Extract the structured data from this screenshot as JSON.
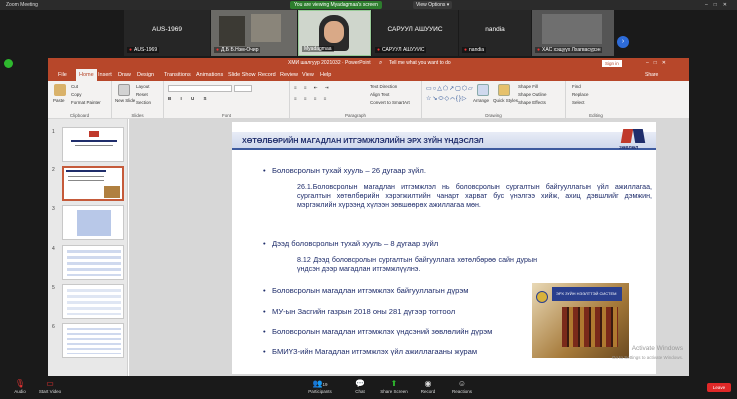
{
  "zoom": {
    "window_title": "Zoom Meeting",
    "viewing_banner": "You are viewing Myadagmaa's screen",
    "view_options": "View Options ▾",
    "participants": [
      {
        "name": "AUS-1969",
        "label": "AUS-1969"
      },
      {
        "name": "",
        "label": "Д.Б Б.Нэм-Очир"
      },
      {
        "name": "",
        "label": "Myadagmaa"
      },
      {
        "name": "САРУУЛ АШУУИС",
        "label": "САРУУЛ АШУУИС"
      },
      {
        "name": "nandia",
        "label": "nandia"
      },
      {
        "name": "",
        "label": "ХАС хэщүүх Лхагвасүрэн"
      }
    ],
    "bottom": {
      "audio": "Audio",
      "video": "Start Video",
      "participants": "Participants",
      "participants_count": "19",
      "chat": "Chat",
      "share": "Share Screen",
      "record": "Record",
      "reactions": "Reactions",
      "leave": "Leave"
    }
  },
  "ppt": {
    "title": "ХМИ шалгуур 2021032 · PowerPoint",
    "search": "Tell me what you want to do",
    "signin": "Sign in",
    "share": "Share",
    "tabs": [
      "File",
      "Home",
      "Insert",
      "Draw",
      "Design",
      "Transitions",
      "Animations",
      "Slide Show",
      "Record",
      "Review",
      "View",
      "Help"
    ],
    "ribbon": {
      "clipboard": "Clipboard",
      "paste": "Paste",
      "cut": "Cut",
      "copy": "Copy",
      "format_painter": "Format Painter",
      "slides": "Slides",
      "new_slide": "New Slide",
      "layout": "Layout",
      "reset": "Reset",
      "section": "Section",
      "font": "Font",
      "paragraph": "Paragraph",
      "text_direction": "Text Direction",
      "align_text": "Align Text",
      "convert_smartart": "Convert to SmartArt",
      "drawing": "Drawing",
      "arrange": "Arrange",
      "quick_styles": "Quick Styles",
      "shape_fill": "Shape Fill",
      "shape_outline": "Shape Outline",
      "shape_effects": "Shape Effects",
      "editing": "Editing",
      "find": "Find",
      "replace": "Replace",
      "select": "Select"
    },
    "slide_numbers": [
      "1",
      "2",
      "3",
      "4",
      "5",
      "6"
    ]
  },
  "slide": {
    "heading": "ХӨТӨЛБӨРИЙН МАГАДЛАН ИТГЭМЖЛЭЛИЙН ЭРХ ЗҮЙН ҮНДЭСЛЭЛ",
    "logo_text": "ЗӨВЛӨЛ",
    "b1": "Боловсролын тухай хууль – 26 дугаар зүйл.",
    "p1": "26.1.Боловсролын магадлан итгэмжлэл нь боловсролын сургалтын байгууллагын үйл ажиллагаа, сургалтын хөтөлбөрийн хэрэгжилтийн чанарт харват бус үнэлгээ хийж, ахиц дэвшлийг дэмжин, мэргэжлийн хүрээнд хүлээн зөвшөөрөх ажиллагаа мөн.",
    "b2": "Дээд боловсролын тухай хууль – 8 дугаар зүйл",
    "p2": "8.12 Дээд боловсролын сургалтын байгууллага хөтөлбөрөө сайн дурын үндсэн дээр магадлан итгэмжлүүлнэ.",
    "b3": "Боловсролын магадлан итгэмжлэх байгууллагын дүрэм",
    "b4": "МУ-ын Засгийн газрын 2018 оны 281 дүгээр тогтоол",
    "b5": "Боловсролын магадлан итгэмжлэх үндсэний зөвлөлийн дүрэм",
    "b6": "БМИҮЗ-ийн Магадлан итгэмжлэх үйл ажиллагааны журам",
    "img_caption": "ЭРХ ЗҮЙН НЭЭЛТТЭЙ СИСТЕМ",
    "activate1": "Activate Windows",
    "activate2": "Go to Settings to activate Windows."
  },
  "colors": {
    "ppt_red": "#b7472a",
    "slide_blue": "#1f2d6b",
    "leave_red": "#e02828",
    "zoom_green": "#2d7d2d"
  }
}
